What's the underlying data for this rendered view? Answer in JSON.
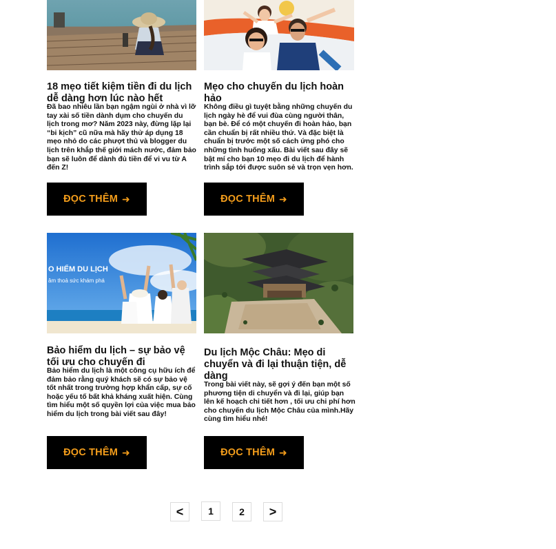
{
  "posts": [
    {
      "title": "18 mẹo tiết kiệm tiền đi du lịch dễ dàng hơn lúc nào hết",
      "excerpt": "Đã bao nhiêu lần bạn ngậm ngùi ở nhà vì lỡ tay xài số tiền dành dụm cho chuyến du lịch trong mơ? Năm 2023 này, đừng lặp lại “bi kịch” cũ nữa mà hãy thử áp dụng 18 mẹo nhỏ do các phượt thủ và blogger du lịch trên khắp thế giới mách nước, đảm bảo bạn sẽ luôn để dành đủ tiền để vi vu từ A đến Z!",
      "button": "ĐỌC THÊM"
    },
    {
      "title": "Mẹo cho chuyến du lịch hoàn hảo",
      "excerpt": "Không điều gì tuyệt bằng những chuyến du lịch ngày hè để vui đùa cùng người thân, bạn bè. Để có một chuyến đi hoàn hảo, bạn cần chuẩn bị rất nhiều thứ. Và đặc biệt là chuẩn bị trước một số cách ứng phó cho những tình huống xấu. Bài viết sau đây sẽ bật mí cho bạn 10 mẹo đi du lịch để hành trình sắp tới được suôn sẻ và trọn vẹn hơn.",
      "button": "ĐỌC THÊM"
    },
    {
      "title": "Bảo hiểm du lịch – sự bảo vệ tối ưu cho chuyến đi",
      "excerpt": "Bảo hiểm du lịch là một công cụ hữu ích để đảm bảo rằng quý khách sẽ có sự bảo vệ tốt nhất trong trường hợp khẩn cấp, sự cố hoặc yếu tố bất khả kháng xuất hiện. Cùng tìm hiểu một số quyền lợi của việc mua bảo hiểm du lịch trong bài viết sau đây!",
      "button": "ĐỌC THÊM",
      "image_text_1": "O HIỂM DU LỊCH",
      "image_text_2": "âm thoả sức khám phá"
    },
    {
      "title": "Du lịch Mộc Châu: Mẹo di chuyển và đi lại thuận tiện, dễ dàng",
      "excerpt": "Trong bài viết này, sẽ gợi ý đến bạn một số phương tiện di chuyển và đi lại, giúp bạn lên kế hoạch chi tiết hơn , tối ưu chi phí hơn cho chuyến du lịch Mộc Châu của mình.Hãy cùng tìm hiểu nhé!",
      "button": "ĐỌC THÊM"
    }
  ],
  "pagination": {
    "prev": "<",
    "pages": [
      "1",
      "2"
    ],
    "next": ">"
  },
  "icons": {
    "button_arrow": "arrow-right-icon"
  },
  "colors": {
    "button_bg": "#000000",
    "button_text": "#f59e1b"
  }
}
